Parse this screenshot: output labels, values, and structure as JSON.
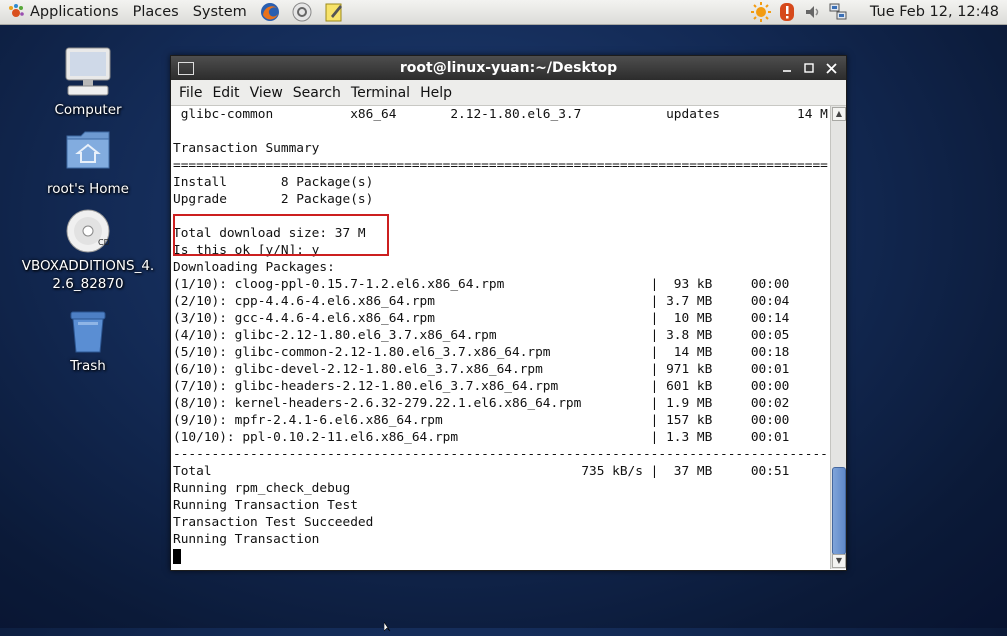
{
  "top_panel": {
    "applications": "Applications",
    "places": "Places",
    "system": "System",
    "clock": "Tue Feb 12, 12:48"
  },
  "desktop": {
    "icons": [
      {
        "label": "Computer"
      },
      {
        "label": "root's Home"
      },
      {
        "label": "VBOXADDITIONS_4.",
        "label2": "2.6_82870",
        "disc_text": "CD"
      },
      {
        "label": "Trash"
      }
    ]
  },
  "window": {
    "title": "root@linux-yuan:~/Desktop",
    "menu": [
      "File",
      "Edit",
      "View",
      "Search",
      "Terminal",
      "Help"
    ]
  },
  "terminal": {
    "lines": [
      " glibc-common          x86_64       2.12-1.80.el6_3.7           updates          14 M",
      "",
      "Transaction Summary",
      "",
      "Install       8 Package(s)",
      "Upgrade       2 Package(s)",
      "",
      "Total download size: 37 M",
      "Is this ok [y/N]: y",
      "Downloading Packages:",
      "(1/10): cloog-ppl-0.15.7-1.2.el6.x86_64.rpm                   |  93 kB     00:00",
      "(2/10): cpp-4.4.6-4.el6.x86_64.rpm                            | 3.7 MB     00:04",
      "(3/10): gcc-4.4.6-4.el6.x86_64.rpm                            |  10 MB     00:14",
      "(4/10): glibc-2.12-1.80.el6_3.7.x86_64.rpm                    | 3.8 MB     00:05",
      "(5/10): glibc-common-2.12-1.80.el6_3.7.x86_64.rpm             |  14 MB     00:18",
      "(6/10): glibc-devel-2.12-1.80.el6_3.7.x86_64.rpm              | 971 kB     00:01",
      "(7/10): glibc-headers-2.12-1.80.el6_3.7.x86_64.rpm            | 601 kB     00:00",
      "(8/10): kernel-headers-2.6.32-279.22.1.el6.x86_64.rpm         | 1.9 MB     00:02",
      "(9/10): mpfr-2.4.1-6.el6.x86_64.rpm                           | 157 kB     00:00",
      "(10/10): ppl-0.10.2-11.el6.x86_64.rpm                         | 1.3 MB     00:01",
      "",
      "Total                                                735 kB/s |  37 MB     00:51",
      "Running rpm_check_debug",
      "Running Transaction Test",
      "Transaction Test Succeeded",
      "Running Transaction"
    ],
    "double_separator": "========================================================================================",
    "dash_separator": "----------------------------------------------------------------------------------------"
  },
  "colors": {
    "highlight": "#cc1f1f",
    "scroll_thumb": "#5f88c8"
  }
}
